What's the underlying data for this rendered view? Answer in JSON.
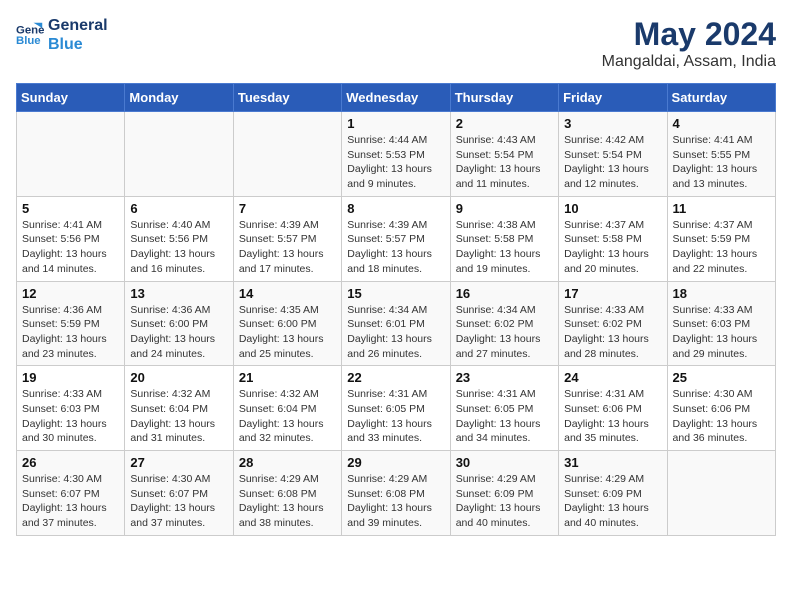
{
  "header": {
    "logo_line1": "General",
    "logo_line2": "Blue",
    "month": "May 2024",
    "location": "Mangaldai, Assam, India"
  },
  "weekdays": [
    "Sunday",
    "Monday",
    "Tuesday",
    "Wednesday",
    "Thursday",
    "Friday",
    "Saturday"
  ],
  "weeks": [
    [
      {
        "day": "",
        "info": ""
      },
      {
        "day": "",
        "info": ""
      },
      {
        "day": "",
        "info": ""
      },
      {
        "day": "1",
        "info": "Sunrise: 4:44 AM\nSunset: 5:53 PM\nDaylight: 13 hours\nand 9 minutes."
      },
      {
        "day": "2",
        "info": "Sunrise: 4:43 AM\nSunset: 5:54 PM\nDaylight: 13 hours\nand 11 minutes."
      },
      {
        "day": "3",
        "info": "Sunrise: 4:42 AM\nSunset: 5:54 PM\nDaylight: 13 hours\nand 12 minutes."
      },
      {
        "day": "4",
        "info": "Sunrise: 4:41 AM\nSunset: 5:55 PM\nDaylight: 13 hours\nand 13 minutes."
      }
    ],
    [
      {
        "day": "5",
        "info": "Sunrise: 4:41 AM\nSunset: 5:56 PM\nDaylight: 13 hours\nand 14 minutes."
      },
      {
        "day": "6",
        "info": "Sunrise: 4:40 AM\nSunset: 5:56 PM\nDaylight: 13 hours\nand 16 minutes."
      },
      {
        "day": "7",
        "info": "Sunrise: 4:39 AM\nSunset: 5:57 PM\nDaylight: 13 hours\nand 17 minutes."
      },
      {
        "day": "8",
        "info": "Sunrise: 4:39 AM\nSunset: 5:57 PM\nDaylight: 13 hours\nand 18 minutes."
      },
      {
        "day": "9",
        "info": "Sunrise: 4:38 AM\nSunset: 5:58 PM\nDaylight: 13 hours\nand 19 minutes."
      },
      {
        "day": "10",
        "info": "Sunrise: 4:37 AM\nSunset: 5:58 PM\nDaylight: 13 hours\nand 20 minutes."
      },
      {
        "day": "11",
        "info": "Sunrise: 4:37 AM\nSunset: 5:59 PM\nDaylight: 13 hours\nand 22 minutes."
      }
    ],
    [
      {
        "day": "12",
        "info": "Sunrise: 4:36 AM\nSunset: 5:59 PM\nDaylight: 13 hours\nand 23 minutes."
      },
      {
        "day": "13",
        "info": "Sunrise: 4:36 AM\nSunset: 6:00 PM\nDaylight: 13 hours\nand 24 minutes."
      },
      {
        "day": "14",
        "info": "Sunrise: 4:35 AM\nSunset: 6:00 PM\nDaylight: 13 hours\nand 25 minutes."
      },
      {
        "day": "15",
        "info": "Sunrise: 4:34 AM\nSunset: 6:01 PM\nDaylight: 13 hours\nand 26 minutes."
      },
      {
        "day": "16",
        "info": "Sunrise: 4:34 AM\nSunset: 6:02 PM\nDaylight: 13 hours\nand 27 minutes."
      },
      {
        "day": "17",
        "info": "Sunrise: 4:33 AM\nSunset: 6:02 PM\nDaylight: 13 hours\nand 28 minutes."
      },
      {
        "day": "18",
        "info": "Sunrise: 4:33 AM\nSunset: 6:03 PM\nDaylight: 13 hours\nand 29 minutes."
      }
    ],
    [
      {
        "day": "19",
        "info": "Sunrise: 4:33 AM\nSunset: 6:03 PM\nDaylight: 13 hours\nand 30 minutes."
      },
      {
        "day": "20",
        "info": "Sunrise: 4:32 AM\nSunset: 6:04 PM\nDaylight: 13 hours\nand 31 minutes."
      },
      {
        "day": "21",
        "info": "Sunrise: 4:32 AM\nSunset: 6:04 PM\nDaylight: 13 hours\nand 32 minutes."
      },
      {
        "day": "22",
        "info": "Sunrise: 4:31 AM\nSunset: 6:05 PM\nDaylight: 13 hours\nand 33 minutes."
      },
      {
        "day": "23",
        "info": "Sunrise: 4:31 AM\nSunset: 6:05 PM\nDaylight: 13 hours\nand 34 minutes."
      },
      {
        "day": "24",
        "info": "Sunrise: 4:31 AM\nSunset: 6:06 PM\nDaylight: 13 hours\nand 35 minutes."
      },
      {
        "day": "25",
        "info": "Sunrise: 4:30 AM\nSunset: 6:06 PM\nDaylight: 13 hours\nand 36 minutes."
      }
    ],
    [
      {
        "day": "26",
        "info": "Sunrise: 4:30 AM\nSunset: 6:07 PM\nDaylight: 13 hours\nand 37 minutes."
      },
      {
        "day": "27",
        "info": "Sunrise: 4:30 AM\nSunset: 6:07 PM\nDaylight: 13 hours\nand 37 minutes."
      },
      {
        "day": "28",
        "info": "Sunrise: 4:29 AM\nSunset: 6:08 PM\nDaylight: 13 hours\nand 38 minutes."
      },
      {
        "day": "29",
        "info": "Sunrise: 4:29 AM\nSunset: 6:08 PM\nDaylight: 13 hours\nand 39 minutes."
      },
      {
        "day": "30",
        "info": "Sunrise: 4:29 AM\nSunset: 6:09 PM\nDaylight: 13 hours\nand 40 minutes."
      },
      {
        "day": "31",
        "info": "Sunrise: 4:29 AM\nSunset: 6:09 PM\nDaylight: 13 hours\nand 40 minutes."
      },
      {
        "day": "",
        "info": ""
      }
    ]
  ]
}
